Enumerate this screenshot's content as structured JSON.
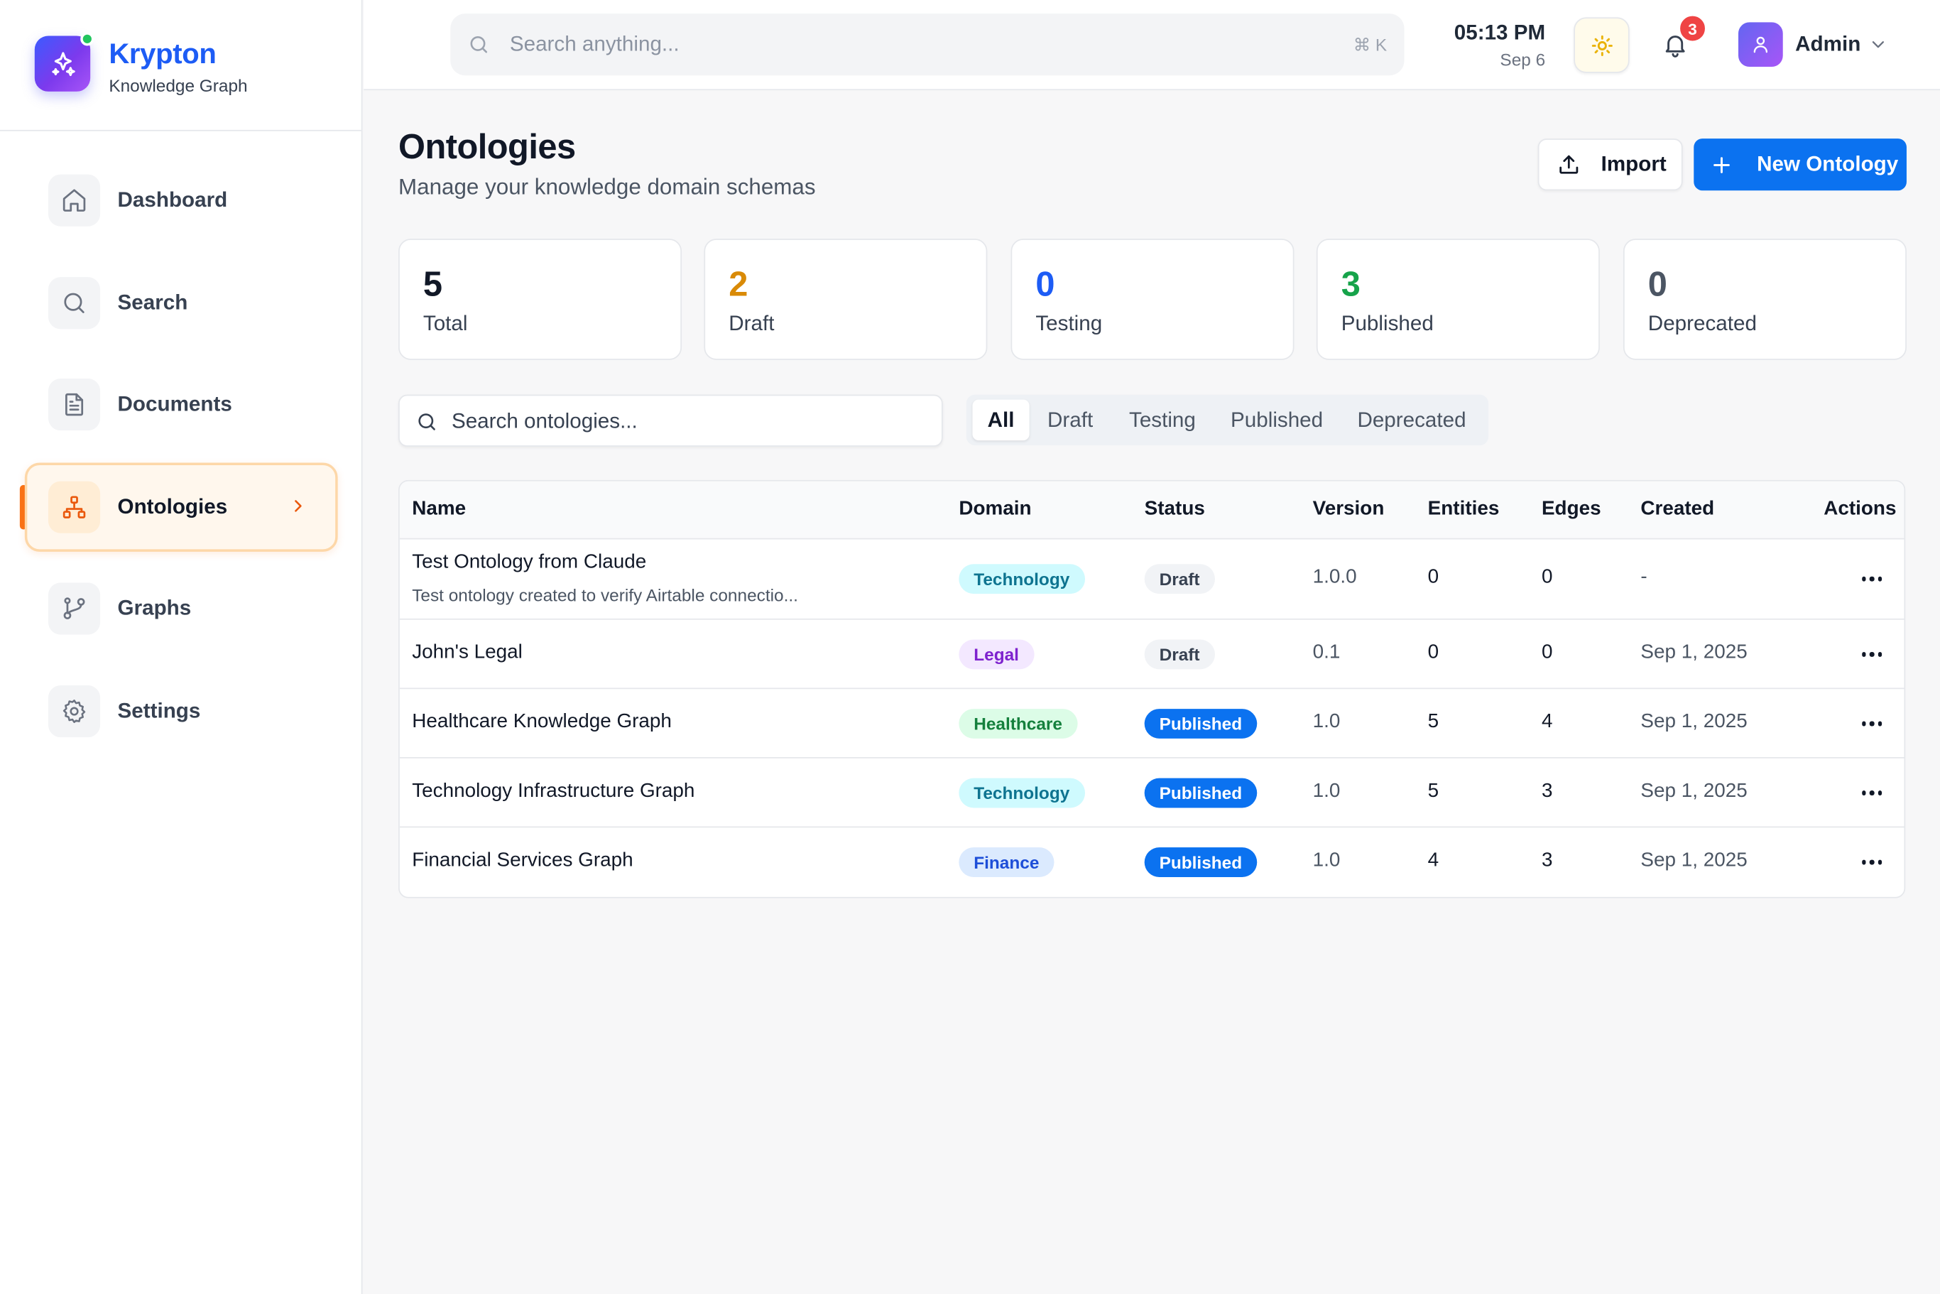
{
  "brand": {
    "name": "Krypton",
    "subtitle": "Knowledge Graph"
  },
  "sidebar": {
    "items": [
      {
        "label": "Dashboard",
        "icon": "home-icon"
      },
      {
        "label": "Search",
        "icon": "search-icon"
      },
      {
        "label": "Documents",
        "icon": "document-icon"
      },
      {
        "label": "Ontologies",
        "icon": "hierarchy-icon",
        "active": true
      },
      {
        "label": "Graphs",
        "icon": "git-branch-icon"
      },
      {
        "label": "Settings",
        "icon": "gear-icon"
      }
    ]
  },
  "topbar": {
    "search_placeholder": "Search anything...",
    "search_shortcut": "⌘ K",
    "time": "05:13 PM",
    "date": "Sep 6",
    "notifications_count": "3",
    "user_name": "Admin"
  },
  "page": {
    "title": "Ontologies",
    "subtitle": "Manage your knowledge domain schemas",
    "import_label": "Import",
    "new_label": "New Ontology"
  },
  "stats": [
    {
      "value": "5",
      "label": "Total",
      "color": "#111827"
    },
    {
      "value": "2",
      "label": "Draft",
      "color": "#d98a06"
    },
    {
      "value": "0",
      "label": "Testing",
      "color": "#1d5cf5"
    },
    {
      "value": "3",
      "label": "Published",
      "color": "#16a34a"
    },
    {
      "value": "0",
      "label": "Deprecated",
      "color": "#4b5563"
    }
  ],
  "filters": {
    "search_placeholder": "Search ontologies...",
    "tabs": [
      "All",
      "Draft",
      "Testing",
      "Published",
      "Deprecated"
    ],
    "active_tab": "All"
  },
  "table": {
    "columns": [
      "Name",
      "Domain",
      "Status",
      "Version",
      "Entities",
      "Edges",
      "Created",
      "Actions"
    ],
    "rows": [
      {
        "name": "Test Ontology from Claude",
        "description": "Test ontology created to verify Airtable connectio...",
        "domain": "Technology",
        "status": "Draft",
        "version": "1.0.0",
        "entities": "0",
        "edges": "0",
        "created": "-"
      },
      {
        "name": "John's Legal",
        "domain": "Legal",
        "status": "Draft",
        "version": "0.1",
        "entities": "0",
        "edges": "0",
        "created": "Sep 1, 2025"
      },
      {
        "name": "Healthcare Knowledge Graph",
        "domain": "Healthcare",
        "status": "Published",
        "version": "1.0",
        "entities": "5",
        "edges": "4",
        "created": "Sep 1, 2025"
      },
      {
        "name": "Technology Infrastructure Graph",
        "domain": "Technology",
        "status": "Published",
        "version": "1.0",
        "entities": "5",
        "edges": "3",
        "created": "Sep 1, 2025"
      },
      {
        "name": "Financial Services Graph",
        "domain": "Finance",
        "status": "Published",
        "version": "1.0",
        "entities": "4",
        "edges": "3",
        "created": "Sep 1, 2025"
      }
    ]
  },
  "colors": {
    "accent": "#0b72f0",
    "active_nav": "#f97316",
    "domain_technology_bg": "#cffafe",
    "domain_technology_fg": "#0e7490",
    "domain_legal_bg": "#f3e8ff",
    "domain_legal_fg": "#7e22ce",
    "domain_healthcare_bg": "#dcfce7",
    "domain_healthcare_fg": "#15803d",
    "domain_finance_bg": "#dbeafe",
    "domain_finance_fg": "#1d4ed8",
    "status_draft_bg": "#f1f3f6",
    "status_draft_fg": "#374151",
    "status_published_bg": "#0b72f0",
    "status_published_fg": "#ffffff"
  }
}
